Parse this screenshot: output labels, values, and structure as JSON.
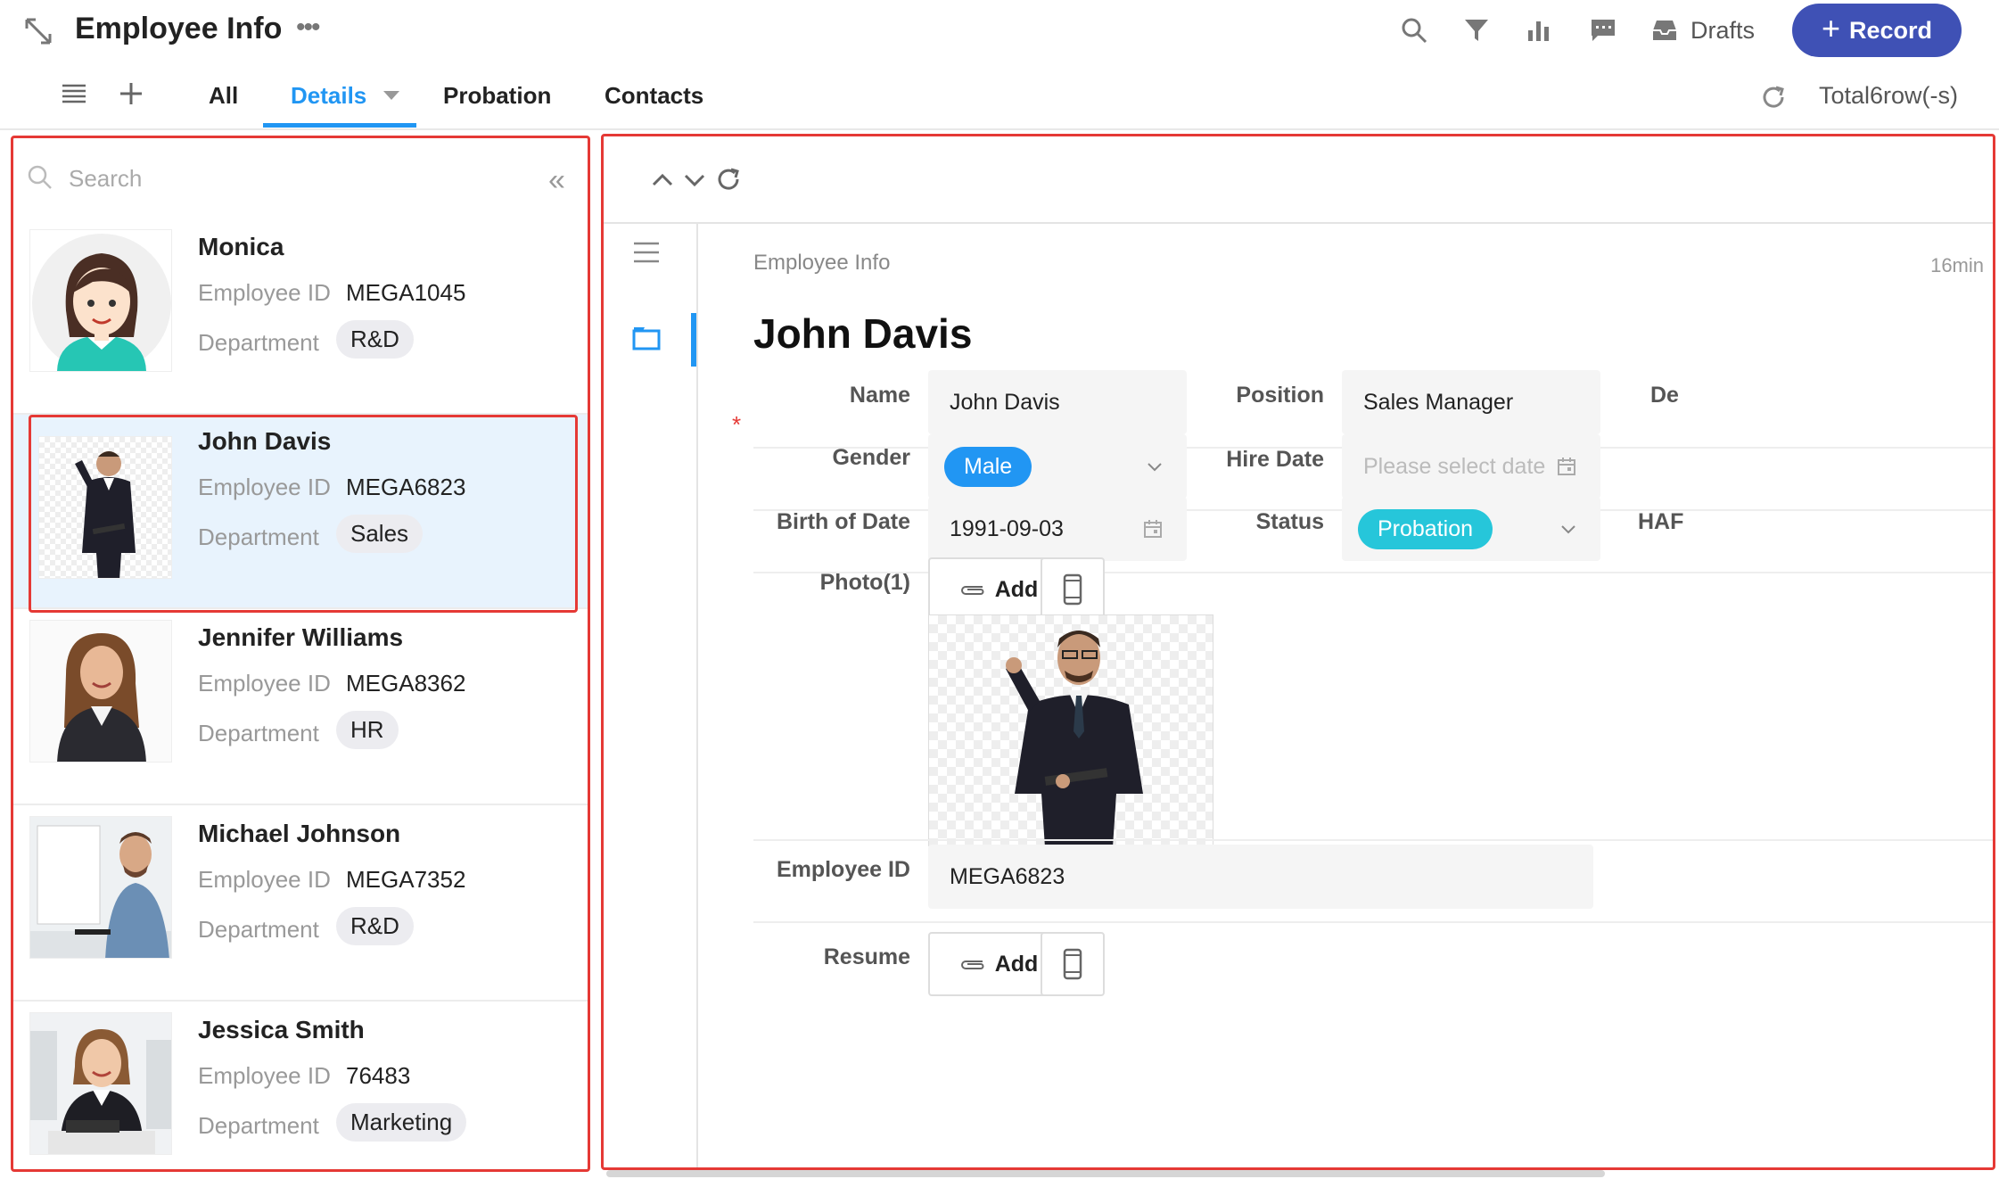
{
  "header": {
    "title": "Employee Info",
    "drafts_label": "Drafts",
    "record_label": "Record",
    "accent_color": "#3f51b5"
  },
  "tabs": [
    {
      "label": "All"
    },
    {
      "label": "Details",
      "active": true
    },
    {
      "label": "Probation"
    },
    {
      "label": "Contacts"
    }
  ],
  "total_label": "Total6row(-s)",
  "search": {
    "placeholder": "Search"
  },
  "employees": [
    {
      "name": "Monica",
      "id_label": "Employee ID",
      "id": "MEGA1045",
      "dept_label": "Department",
      "dept": "R&D"
    },
    {
      "name": "John Davis",
      "id_label": "Employee ID",
      "id": "MEGA6823",
      "dept_label": "Department",
      "dept": "Sales",
      "selected": true
    },
    {
      "name": "Jennifer Williams",
      "id_label": "Employee ID",
      "id": "MEGA8362",
      "dept_label": "Department",
      "dept": "HR"
    },
    {
      "name": "Michael Johnson",
      "id_label": "Employee ID",
      "id": "MEGA7352",
      "dept_label": "Department",
      "dept": "R&D"
    },
    {
      "name": "Jessica Smith",
      "id_label": "Employee ID",
      "id": "76483",
      "dept_label": "Department",
      "dept": "Marketing"
    }
  ],
  "detail": {
    "breadcrumb": "Employee Info",
    "time_ago": "16min",
    "title": "John Davis",
    "fields": {
      "name_label": "Name",
      "name_value": "John Davis",
      "position_label": "Position",
      "position_value": "Sales Manager",
      "dept_label_cut": "De",
      "gender_label": "Gender",
      "gender_value": "Male",
      "gender_color": "#2196f3",
      "hire_label": "Hire Date",
      "hire_placeholder": "Please select date",
      "birth_label": "Birth of Date",
      "birth_value": "1991-09-03",
      "status_label": "Status",
      "status_value": "Probation",
      "status_color": "#26c6da",
      "har_label_cut": "HAF",
      "photo_label": "Photo(1)",
      "add_label": "Add",
      "empid_label": "Employee ID",
      "empid_value": "MEGA6823",
      "resume_label": "Resume"
    }
  }
}
